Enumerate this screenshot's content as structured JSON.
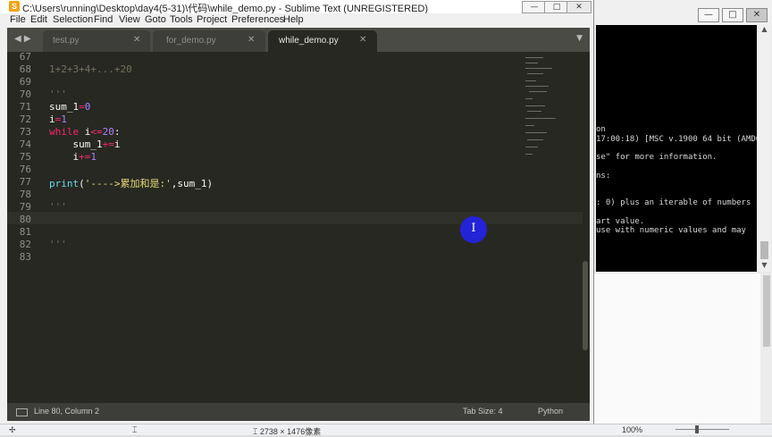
{
  "window": {
    "title": "C:\\Users\\running\\Desktop\\day4(5-31)\\代码\\while_demo.py - Sublime Text (UNREGISTERED)",
    "controls": {
      "minimize": "—",
      "maximize": "□",
      "close": "✕"
    }
  },
  "menu": [
    "File",
    "Edit",
    "Selection",
    "Find",
    "View",
    "Goto",
    "Tools",
    "Project",
    "Preferences",
    "Help"
  ],
  "tab_nav": "◀ ▶",
  "tab_dropdown": "▼",
  "tabs": [
    {
      "label": "test.py",
      "close": "✕"
    },
    {
      "label": "for_demo.py",
      "close": "✕"
    },
    {
      "label": "while_demo.py",
      "close": "✕"
    }
  ],
  "editor": {
    "line_numbers": [
      "67",
      "68",
      "69",
      "70",
      "71",
      "72",
      "73",
      "74",
      "75",
      "76",
      "77",
      "78",
      "79",
      "80",
      "81",
      "82",
      "83"
    ],
    "code": {
      "l68": "1+2+3+4+...+20",
      "l70": "'''",
      "l71_var": "sum_1",
      "l71_op": "=",
      "l71_num": "0",
      "l72_var": "i",
      "l72_op": "=",
      "l72_num": "1",
      "l73_kw": "while",
      "l73_var": " i",
      "l73_op": "<=",
      "l73_num": "20",
      "l73_end": ":",
      "l74_var": "    sum_1",
      "l74_op": "+=",
      "l74_end": "i",
      "l75_var": "    i",
      "l75_op": "+=",
      "l75_num": "1",
      "l77_fn": "print",
      "l77_open": "(",
      "l77_str": "'---->累加和是:'",
      "l77_end": ",sum_1)",
      "l78": "'''",
      "l82": "'''"
    }
  },
  "status": {
    "position": "Line 80, Column 2",
    "tab_size": "Tab Size: 4",
    "syntax": "Python"
  },
  "console": {
    "controls": {
      "minimize": "—",
      "maximize": "□",
      "close": "✕"
    },
    "lines": [
      "on",
      "17:00:18) [MSC v.1900 64 bit (AMD6",
      "se\" for more information.",
      "ns:",
      ": 0) plus an iterable of numbers",
      "art value.",
      " use with numeric values and may"
    ],
    "scroll_up": "▲",
    "scroll_down": "▼"
  },
  "taskbar": {
    "move_icon": "✢",
    "select_icon": "⌶",
    "dimensions": "⌶ 2738 × 1476像素",
    "zoom": "100%"
  },
  "cursor_symbol": "I"
}
